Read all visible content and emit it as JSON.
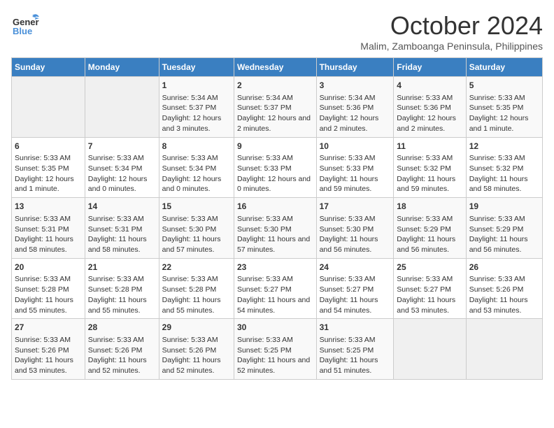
{
  "header": {
    "logo_line1": "General",
    "logo_line2": "Blue",
    "month": "October 2024",
    "location": "Malim, Zamboanga Peninsula, Philippines"
  },
  "days_of_week": [
    "Sunday",
    "Monday",
    "Tuesday",
    "Wednesday",
    "Thursday",
    "Friday",
    "Saturday"
  ],
  "weeks": [
    [
      {
        "day": "",
        "content": ""
      },
      {
        "day": "",
        "content": ""
      },
      {
        "day": "1",
        "content": "Sunrise: 5:34 AM\nSunset: 5:37 PM\nDaylight: 12 hours and 3 minutes."
      },
      {
        "day": "2",
        "content": "Sunrise: 5:34 AM\nSunset: 5:37 PM\nDaylight: 12 hours and 2 minutes."
      },
      {
        "day": "3",
        "content": "Sunrise: 5:34 AM\nSunset: 5:36 PM\nDaylight: 12 hours and 2 minutes."
      },
      {
        "day": "4",
        "content": "Sunrise: 5:33 AM\nSunset: 5:36 PM\nDaylight: 12 hours and 2 minutes."
      },
      {
        "day": "5",
        "content": "Sunrise: 5:33 AM\nSunset: 5:35 PM\nDaylight: 12 hours and 1 minute."
      }
    ],
    [
      {
        "day": "6",
        "content": "Sunrise: 5:33 AM\nSunset: 5:35 PM\nDaylight: 12 hours and 1 minute."
      },
      {
        "day": "7",
        "content": "Sunrise: 5:33 AM\nSunset: 5:34 PM\nDaylight: 12 hours and 0 minutes."
      },
      {
        "day": "8",
        "content": "Sunrise: 5:33 AM\nSunset: 5:34 PM\nDaylight: 12 hours and 0 minutes."
      },
      {
        "day": "9",
        "content": "Sunrise: 5:33 AM\nSunset: 5:33 PM\nDaylight: 12 hours and 0 minutes."
      },
      {
        "day": "10",
        "content": "Sunrise: 5:33 AM\nSunset: 5:33 PM\nDaylight: 11 hours and 59 minutes."
      },
      {
        "day": "11",
        "content": "Sunrise: 5:33 AM\nSunset: 5:32 PM\nDaylight: 11 hours and 59 minutes."
      },
      {
        "day": "12",
        "content": "Sunrise: 5:33 AM\nSunset: 5:32 PM\nDaylight: 11 hours and 58 minutes."
      }
    ],
    [
      {
        "day": "13",
        "content": "Sunrise: 5:33 AM\nSunset: 5:31 PM\nDaylight: 11 hours and 58 minutes."
      },
      {
        "day": "14",
        "content": "Sunrise: 5:33 AM\nSunset: 5:31 PM\nDaylight: 11 hours and 58 minutes."
      },
      {
        "day": "15",
        "content": "Sunrise: 5:33 AM\nSunset: 5:30 PM\nDaylight: 11 hours and 57 minutes."
      },
      {
        "day": "16",
        "content": "Sunrise: 5:33 AM\nSunset: 5:30 PM\nDaylight: 11 hours and 57 minutes."
      },
      {
        "day": "17",
        "content": "Sunrise: 5:33 AM\nSunset: 5:30 PM\nDaylight: 11 hours and 56 minutes."
      },
      {
        "day": "18",
        "content": "Sunrise: 5:33 AM\nSunset: 5:29 PM\nDaylight: 11 hours and 56 minutes."
      },
      {
        "day": "19",
        "content": "Sunrise: 5:33 AM\nSunset: 5:29 PM\nDaylight: 11 hours and 56 minutes."
      }
    ],
    [
      {
        "day": "20",
        "content": "Sunrise: 5:33 AM\nSunset: 5:28 PM\nDaylight: 11 hours and 55 minutes."
      },
      {
        "day": "21",
        "content": "Sunrise: 5:33 AM\nSunset: 5:28 PM\nDaylight: 11 hours and 55 minutes."
      },
      {
        "day": "22",
        "content": "Sunrise: 5:33 AM\nSunset: 5:28 PM\nDaylight: 11 hours and 55 minutes."
      },
      {
        "day": "23",
        "content": "Sunrise: 5:33 AM\nSunset: 5:27 PM\nDaylight: 11 hours and 54 minutes."
      },
      {
        "day": "24",
        "content": "Sunrise: 5:33 AM\nSunset: 5:27 PM\nDaylight: 11 hours and 54 minutes."
      },
      {
        "day": "25",
        "content": "Sunrise: 5:33 AM\nSunset: 5:27 PM\nDaylight: 11 hours and 53 minutes."
      },
      {
        "day": "26",
        "content": "Sunrise: 5:33 AM\nSunset: 5:26 PM\nDaylight: 11 hours and 53 minutes."
      }
    ],
    [
      {
        "day": "27",
        "content": "Sunrise: 5:33 AM\nSunset: 5:26 PM\nDaylight: 11 hours and 53 minutes."
      },
      {
        "day": "28",
        "content": "Sunrise: 5:33 AM\nSunset: 5:26 PM\nDaylight: 11 hours and 52 minutes."
      },
      {
        "day": "29",
        "content": "Sunrise: 5:33 AM\nSunset: 5:26 PM\nDaylight: 11 hours and 52 minutes."
      },
      {
        "day": "30",
        "content": "Sunrise: 5:33 AM\nSunset: 5:25 PM\nDaylight: 11 hours and 52 minutes."
      },
      {
        "day": "31",
        "content": "Sunrise: 5:33 AM\nSunset: 5:25 PM\nDaylight: 11 hours and 51 minutes."
      },
      {
        "day": "",
        "content": ""
      },
      {
        "day": "",
        "content": ""
      }
    ]
  ]
}
